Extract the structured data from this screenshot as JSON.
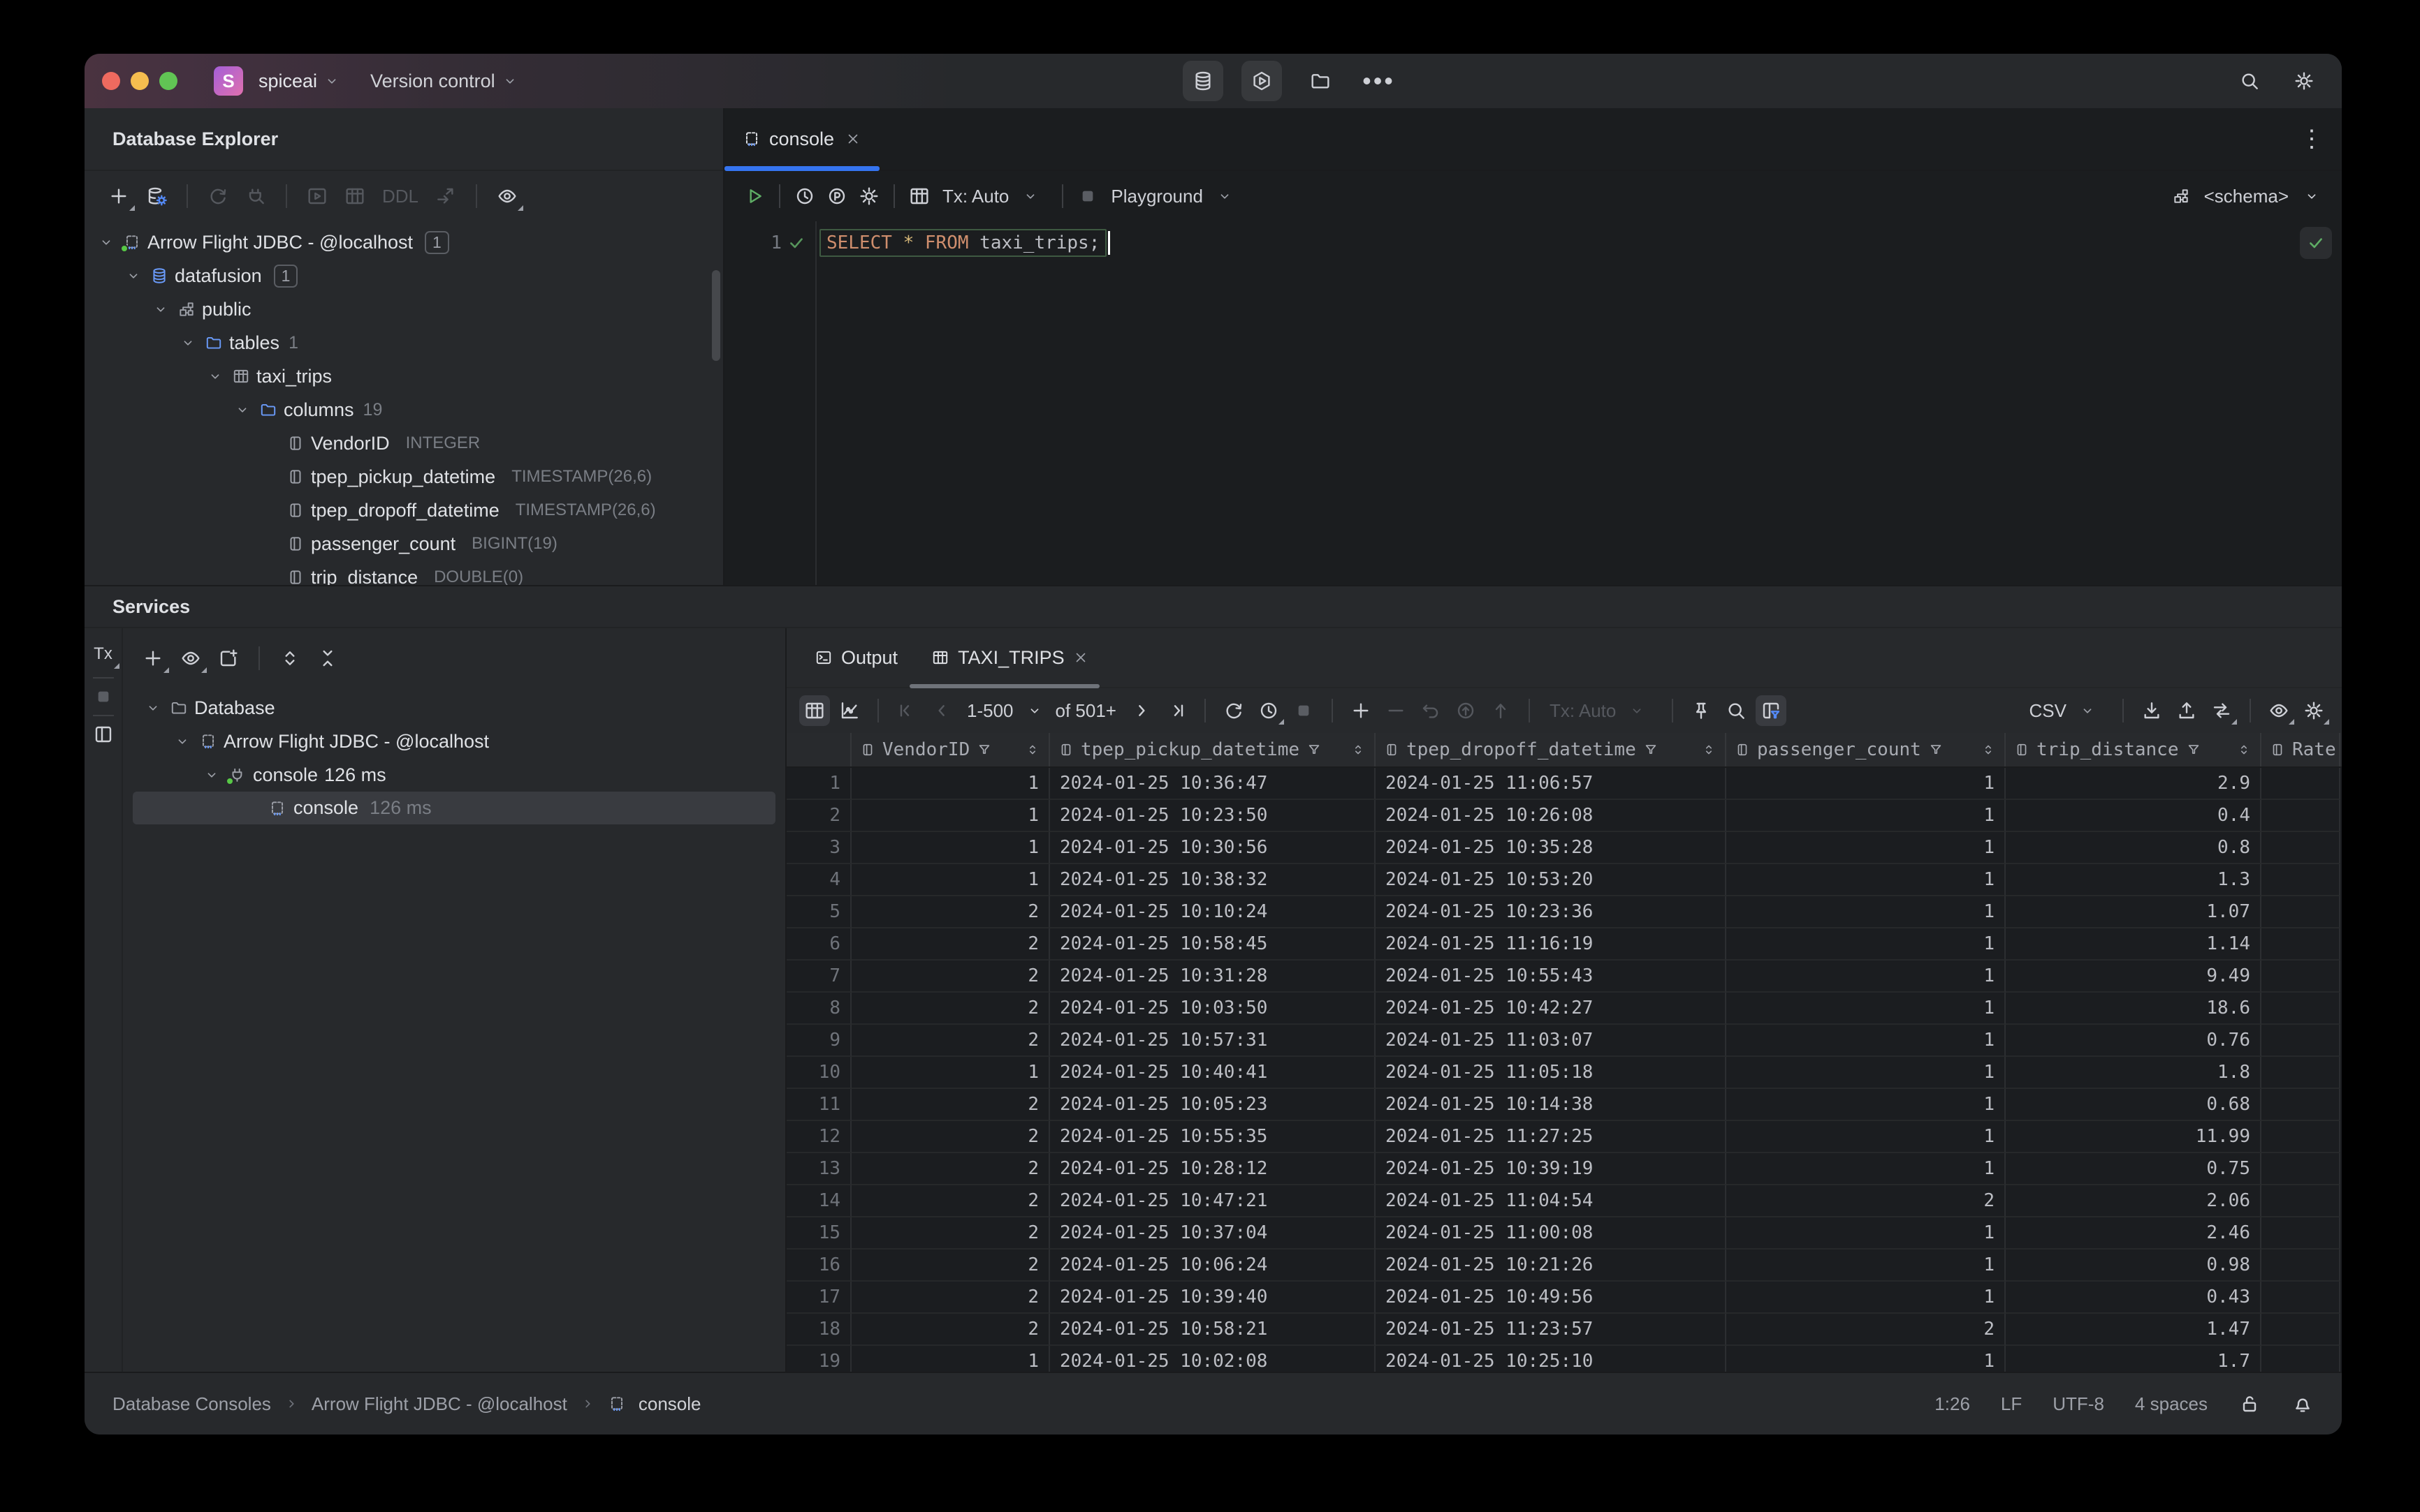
{
  "colors": {
    "accent": "#3574f0",
    "green": "#5fad65",
    "keyword_orange": "#cf8e6d",
    "star_yellow": "#d5b778",
    "traffic_red": "#ee6a5f",
    "traffic_yellow": "#f5bd4f",
    "traffic_green": "#61c454"
  },
  "titlebar": {
    "project_initial": "S",
    "project": "spiceai",
    "menu": "Version control",
    "center_icons": [
      "database-icon",
      "hexagon-play-icon",
      "folder-icon",
      "more-icon"
    ],
    "right_icons": [
      "search-icon",
      "settings-icon"
    ]
  },
  "explorer": {
    "title": "Database Explorer",
    "toolbar": {
      "ddl_label": "DDL"
    },
    "tree": [
      {
        "level": 0,
        "chevron": true,
        "icon": "datasource-icon",
        "label": "Arrow Flight JDBC - @localhost",
        "badge": "1",
        "green_dot": true
      },
      {
        "level": 1,
        "chevron": true,
        "icon": "database-icon",
        "label": "datafusion",
        "badge": "1"
      },
      {
        "level": 2,
        "chevron": true,
        "icon": "schema-icon",
        "label": "public"
      },
      {
        "level": 3,
        "chevron": true,
        "icon": "folder-icon",
        "label": "tables",
        "count": "1"
      },
      {
        "level": 4,
        "chevron": true,
        "icon": "table-icon",
        "label": "taxi_trips"
      },
      {
        "level": 5,
        "chevron": true,
        "icon": "folder-icon",
        "label": "columns",
        "count": "19"
      },
      {
        "level": 6,
        "chevron": false,
        "icon": "column-icon",
        "label": "VendorID",
        "type": "INTEGER"
      },
      {
        "level": 6,
        "chevron": false,
        "icon": "column-icon",
        "label": "tpep_pickup_datetime",
        "type": "TIMESTAMP(26,6)"
      },
      {
        "level": 6,
        "chevron": false,
        "icon": "column-icon",
        "label": "tpep_dropoff_datetime",
        "type": "TIMESTAMP(26,6)"
      },
      {
        "level": 6,
        "chevron": false,
        "icon": "column-icon",
        "label": "passenger_count",
        "type": "BIGINT(19)"
      },
      {
        "level": 6,
        "chevron": false,
        "icon": "column-icon",
        "label": "trip_distance",
        "type": "DOUBLE(0)"
      }
    ]
  },
  "editor": {
    "tab": "console",
    "toolbar": {
      "tx": "Tx: Auto",
      "playground": "Playground",
      "schema": "<schema>"
    },
    "line_number": "1",
    "sql": {
      "kw1": "SELECT",
      "star": "*",
      "kw2": "FROM",
      "table": "taxi_trips;"
    }
  },
  "services": {
    "title": "Services",
    "strip_label": "Tx",
    "tree": [
      {
        "level": 0,
        "chevron": true,
        "icon": "folder-icon",
        "label": "Database"
      },
      {
        "level": 1,
        "chevron": true,
        "icon": "datasource-icon",
        "label": "Arrow Flight JDBC - @localhost"
      },
      {
        "level": 2,
        "chevron": true,
        "icon": "plug-icon",
        "label": "console",
        "time": "126 ms",
        "green_dot": true
      },
      {
        "level": 3,
        "chevron": false,
        "icon": "datasource-icon",
        "label": "console",
        "time": "126 ms",
        "selected": true
      }
    ]
  },
  "results": {
    "tabs": {
      "output": "Output",
      "grid": "TAXI_TRIPS"
    },
    "toolbar": {
      "range": "1-500",
      "of": "of 501+",
      "tx": "Tx: Auto",
      "format": "CSV"
    },
    "grid": {
      "columns": [
        "",
        "VendorID",
        "tpep_pickup_datetime",
        "tpep_dropoff_datetime",
        "passenger_count",
        "trip_distance",
        "Rate"
      ],
      "rows": [
        [
          "1",
          "1",
          "2024-01-25 10:36:47",
          "2024-01-25 11:06:57",
          "1",
          "2.9"
        ],
        [
          "2",
          "1",
          "2024-01-25 10:23:50",
          "2024-01-25 10:26:08",
          "1",
          "0.4"
        ],
        [
          "3",
          "1",
          "2024-01-25 10:30:56",
          "2024-01-25 10:35:28",
          "1",
          "0.8"
        ],
        [
          "4",
          "1",
          "2024-01-25 10:38:32",
          "2024-01-25 10:53:20",
          "1",
          "1.3"
        ],
        [
          "5",
          "2",
          "2024-01-25 10:10:24",
          "2024-01-25 10:23:36",
          "1",
          "1.07"
        ],
        [
          "6",
          "2",
          "2024-01-25 10:58:45",
          "2024-01-25 11:16:19",
          "1",
          "1.14"
        ],
        [
          "7",
          "2",
          "2024-01-25 10:31:28",
          "2024-01-25 10:55:43",
          "1",
          "9.49"
        ],
        [
          "8",
          "2",
          "2024-01-25 10:03:50",
          "2024-01-25 10:42:27",
          "1",
          "18.6"
        ],
        [
          "9",
          "2",
          "2024-01-25 10:57:31",
          "2024-01-25 11:03:07",
          "1",
          "0.76"
        ],
        [
          "10",
          "1",
          "2024-01-25 10:40:41",
          "2024-01-25 11:05:18",
          "1",
          "1.8"
        ],
        [
          "11",
          "2",
          "2024-01-25 10:05:23",
          "2024-01-25 10:14:38",
          "1",
          "0.68"
        ],
        [
          "12",
          "2",
          "2024-01-25 10:55:35",
          "2024-01-25 11:27:25",
          "1",
          "11.99"
        ],
        [
          "13",
          "2",
          "2024-01-25 10:28:12",
          "2024-01-25 10:39:19",
          "1",
          "0.75"
        ],
        [
          "14",
          "2",
          "2024-01-25 10:47:21",
          "2024-01-25 11:04:54",
          "2",
          "2.06"
        ],
        [
          "15",
          "2",
          "2024-01-25 10:37:04",
          "2024-01-25 11:00:08",
          "1",
          "2.46"
        ],
        [
          "16",
          "2",
          "2024-01-25 10:06:24",
          "2024-01-25 10:21:26",
          "1",
          "0.98"
        ],
        [
          "17",
          "2",
          "2024-01-25 10:39:40",
          "2024-01-25 10:49:56",
          "1",
          "0.43"
        ],
        [
          "18",
          "2",
          "2024-01-25 10:58:21",
          "2024-01-25 11:23:57",
          "2",
          "1.47"
        ],
        [
          "19",
          "1",
          "2024-01-25 10:02:08",
          "2024-01-25 10:25:10",
          "1",
          "1.7"
        ]
      ]
    }
  },
  "statusbar": {
    "breadcrumbs": [
      "Database Consoles",
      "Arrow Flight JDBC - @localhost",
      "console"
    ],
    "caret": "1:26",
    "line_ending": "LF",
    "encoding": "UTF-8",
    "indent": "4 spaces"
  }
}
